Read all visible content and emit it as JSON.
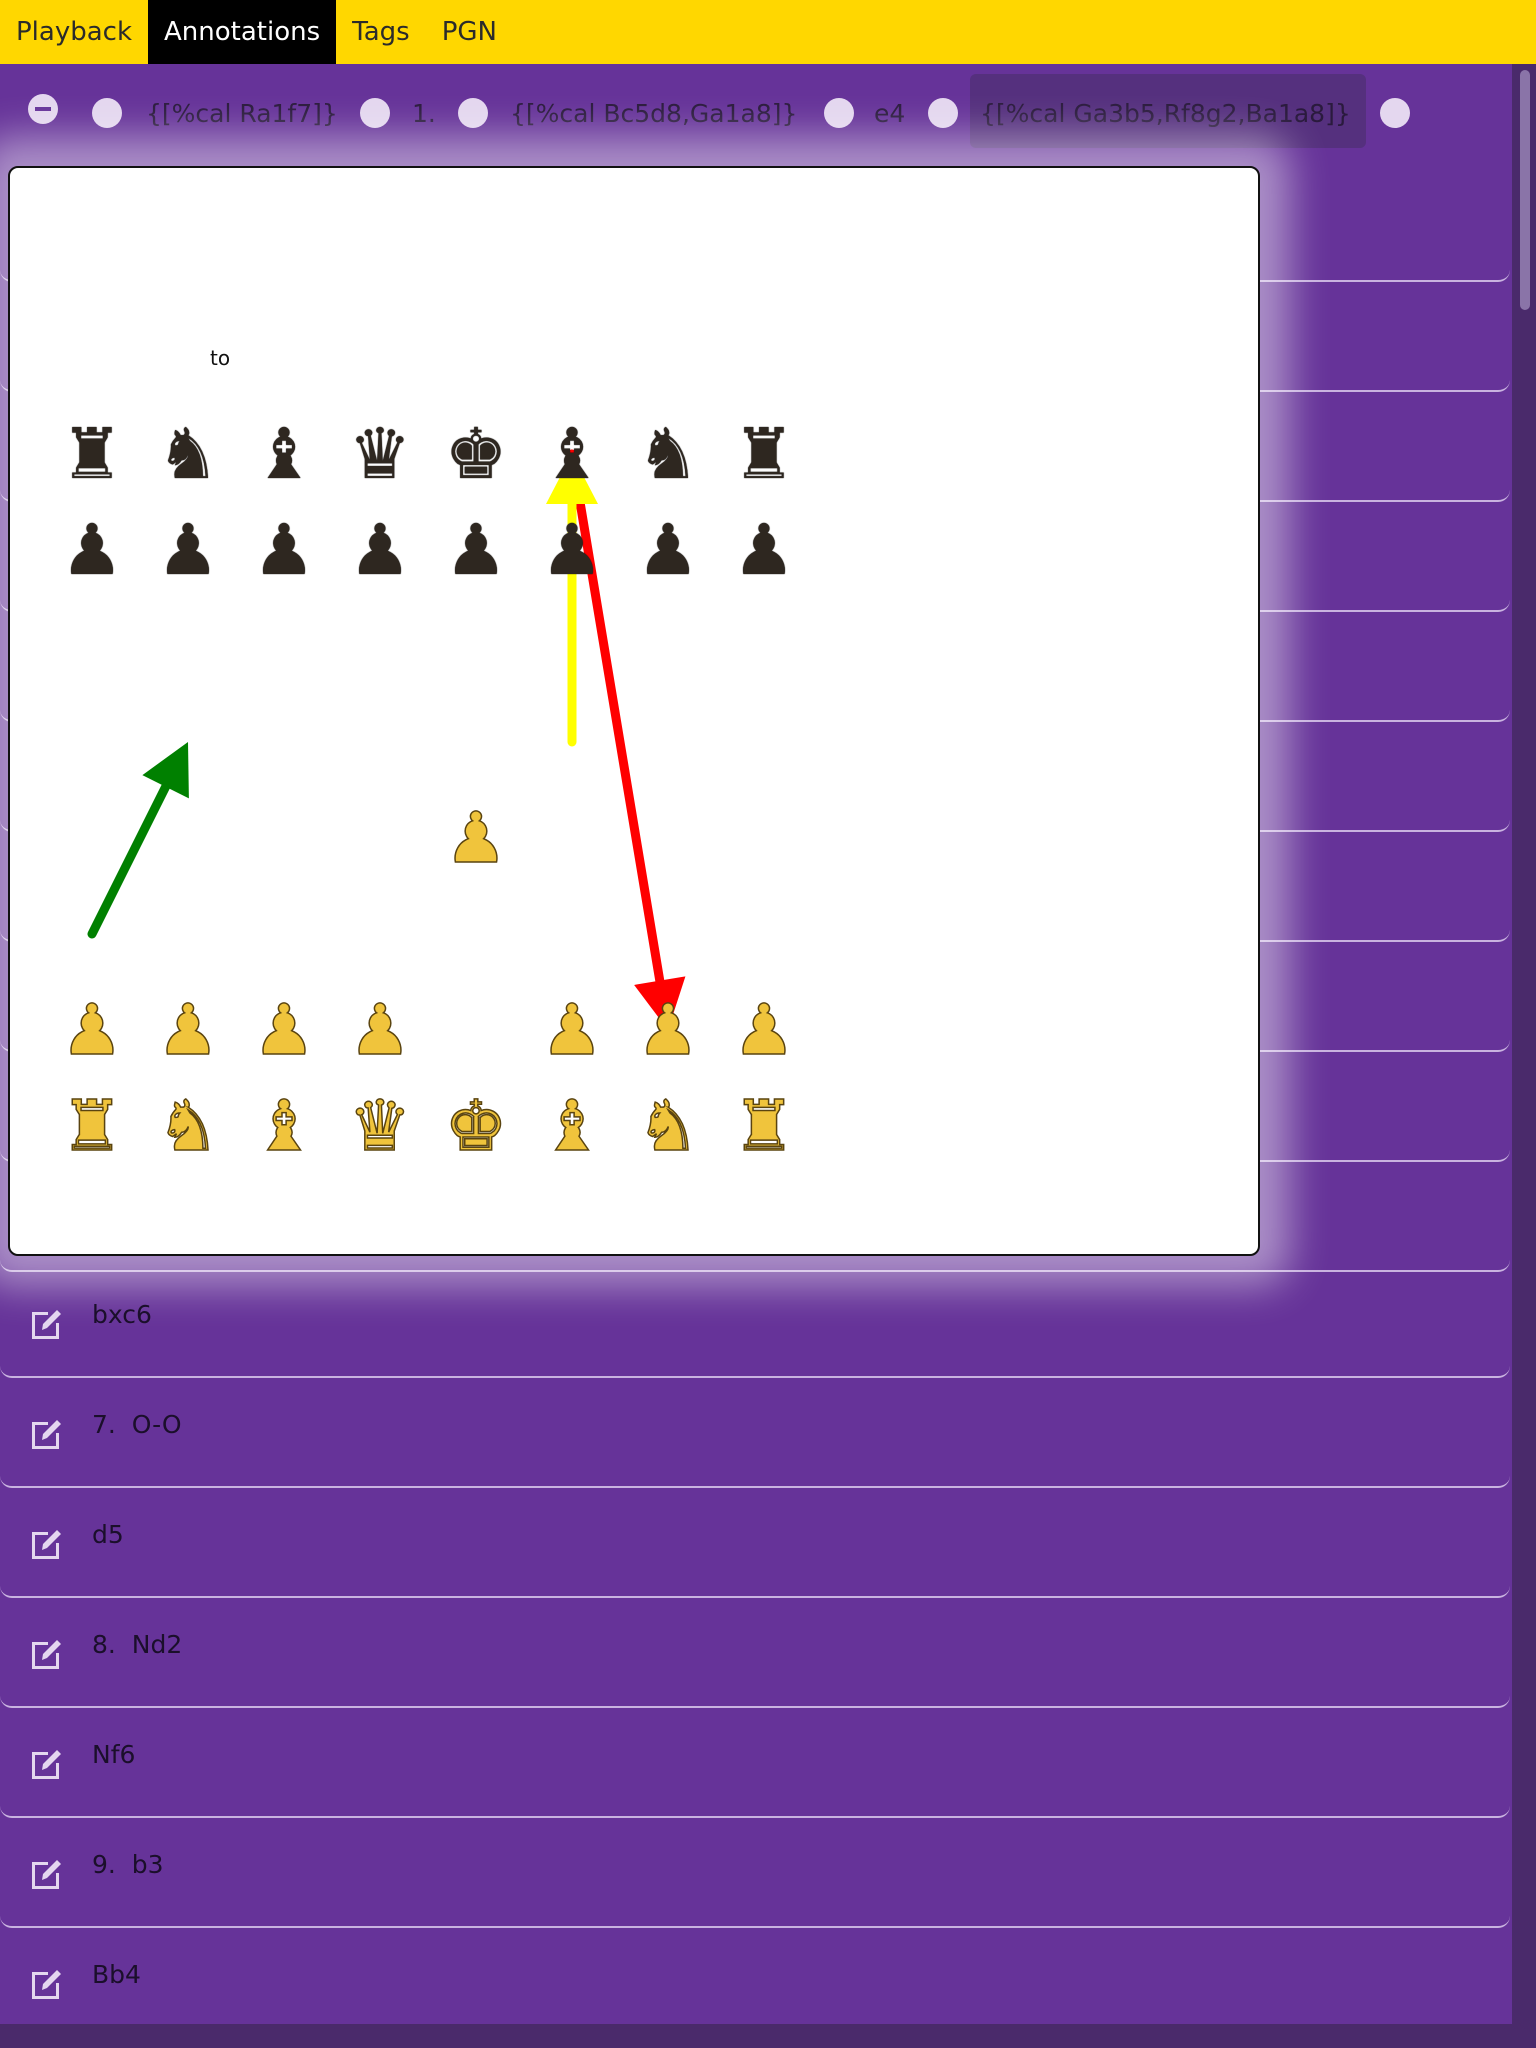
{
  "tabs": [
    {
      "label": "Playback",
      "active": false
    },
    {
      "label": "Annotations",
      "active": true
    },
    {
      "label": "Tags",
      "active": false
    },
    {
      "label": "PGN",
      "active": false
    }
  ],
  "annotation_row": {
    "tokens": [
      "{[%cal Ra1f7]}",
      "1.",
      "{[%cal Bc5d8,Ga1a8]}",
      "e4",
      "{[%cal Ga3b5,Rf8g2,Ba1a8]}"
    ]
  },
  "popup": {
    "label": "to",
    "board": {
      "ranks_top_to_bottom": [
        [
          "br",
          "bn",
          "bb",
          "bq",
          "bk",
          "bb",
          "bn",
          "br"
        ],
        [
          "bp",
          "bp",
          "bp",
          "bp",
          "bp",
          "bp",
          "bp",
          "bp"
        ],
        [
          "",
          "",
          "",
          "",
          "",
          "",
          "",
          ""
        ],
        [
          "",
          "",
          "",
          "",
          "",
          "",
          "",
          ""
        ],
        [
          "",
          "",
          "",
          "",
          "wp",
          "",
          "",
          ""
        ],
        [
          "",
          "",
          "",
          "",
          "",
          "",
          "",
          ""
        ],
        [
          "wp",
          "wp",
          "wp",
          "wp",
          "",
          "wp",
          "wp",
          "wp"
        ],
        [
          "wr",
          "wn",
          "wb",
          "wq",
          "wk",
          "wb",
          "wn",
          "wr"
        ]
      ],
      "arrows": [
        {
          "from": "a3",
          "to": "b5",
          "color": "#008000"
        },
        {
          "from": "f8",
          "to": "g2",
          "color": "#ff0000"
        },
        {
          "from": "f5",
          "to": "f8",
          "color": "#ffff00"
        }
      ]
    }
  },
  "move_list": [
    "bxc6",
    "7.  O-O",
    "d5",
    "8.  Nd2",
    "Nf6",
    "9.  b3",
    "Bb4"
  ],
  "colors": {
    "tabbar": "#ffd700",
    "list_bg": "#663399",
    "accent_dot": "#e4d7ef"
  }
}
